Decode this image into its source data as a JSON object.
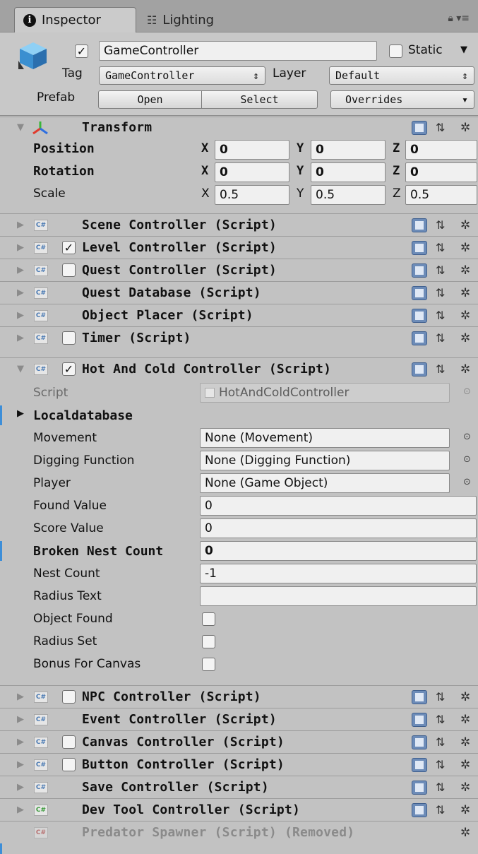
{
  "tabs": {
    "inspector": "Inspector",
    "lighting": "Lighting"
  },
  "object": {
    "name": "GameController",
    "static_label": "Static",
    "tag_label": "Tag",
    "tag_value": "GameController",
    "layer_label": "Layer",
    "layer_value": "Default",
    "prefab_label": "Prefab",
    "prefab_open": "Open",
    "prefab_select": "Select",
    "prefab_overrides": "Overrides"
  },
  "transform": {
    "title": "Transform",
    "position_label": "Position",
    "rotation_label": "Rotation",
    "scale_label": "Scale",
    "axis_x": "X",
    "axis_y": "Y",
    "axis_z": "Z",
    "position": [
      "0",
      "0",
      "0"
    ],
    "rotation": [
      "0",
      "0",
      "0"
    ],
    "scale": [
      "0.5",
      "0.5",
      "0.5"
    ]
  },
  "components_top": [
    {
      "title": "Scene Controller (Script)"
    },
    {
      "title": "Level Controller (Script)"
    },
    {
      "title": "Quest Controller (Script)"
    },
    {
      "title": "Quest Database (Script)"
    },
    {
      "title": "Object Placer (Script)"
    },
    {
      "title": "Timer (Script)"
    }
  ],
  "hot_cold": {
    "title": "Hot And Cold Controller (Script)",
    "script_label": "Script",
    "script_value": "HotAndColdController",
    "localdatabase": "Localdatabase",
    "movement_label": "Movement",
    "movement_value": "None (Movement)",
    "digging_label": "Digging Function",
    "digging_value": "None (Digging Function)",
    "player_label": "Player",
    "player_value": "None (Game Object)",
    "found_label": "Found Value",
    "found_value": "0",
    "score_label": "Score Value",
    "score_value": "0",
    "broken_label": "Broken Nest Count",
    "broken_value": "0",
    "nest_label": "Nest Count",
    "nest_value": "-1",
    "radius_text_label": "Radius Text",
    "radius_text_value": "",
    "object_found_label": "Object Found",
    "radius_set_label": "Radius Set",
    "bonus_label": "Bonus For Canvas"
  },
  "components_bottom": [
    {
      "title": "NPC Controller (Script)"
    },
    {
      "title": "Event Controller (Script)"
    },
    {
      "title": "Canvas Controller (Script)"
    },
    {
      "title": "Button Controller (Script)"
    },
    {
      "title": "Save Controller (Script)"
    },
    {
      "title": "Dev Tool Controller (Script)"
    },
    {
      "title": "Predator Spawner (Script) (Removed)"
    }
  ],
  "icons": {
    "cs": "C#",
    "check": "✓",
    "gear": "✲",
    "sliders": "⇅"
  },
  "colors": {
    "selection": "#3d8ed8",
    "panel": "#c2c2c2"
  }
}
